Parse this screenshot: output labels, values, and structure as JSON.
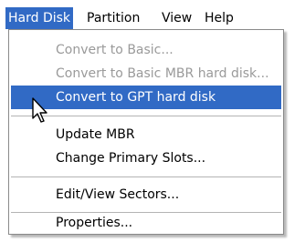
{
  "menubar": {
    "items": [
      {
        "label": "Hard Disk",
        "active": true
      },
      {
        "label": "Partition",
        "active": false
      },
      {
        "label": "View",
        "active": false
      },
      {
        "label": "Help",
        "active": false
      }
    ]
  },
  "dropdown": {
    "items": [
      {
        "label": "Convert to Basic...",
        "enabled": false
      },
      {
        "label": "Convert to Basic MBR hard disk...",
        "enabled": false
      },
      {
        "label": "Convert to GPT hard disk",
        "enabled": true,
        "highlighted": true
      },
      {
        "label": "Update MBR",
        "enabled": true
      },
      {
        "label": "Change Primary Slots...",
        "enabled": true
      },
      {
        "label": "Edit/View Sectors...",
        "enabled": true
      },
      {
        "label": "Properties...",
        "enabled": true
      }
    ]
  },
  "colors": {
    "highlight": "#316ac5",
    "disabled_text": "#9a9a9a"
  },
  "icons": {
    "cursor": "mouse-pointer-icon"
  }
}
